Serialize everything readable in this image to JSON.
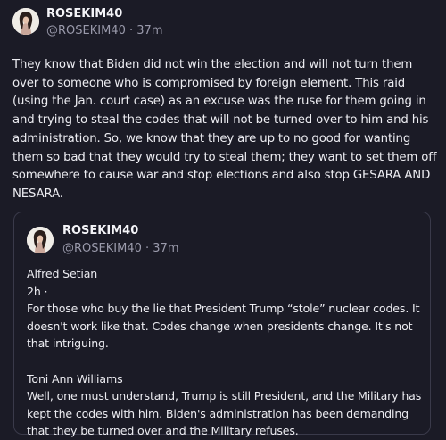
{
  "post": {
    "author_name": "ROSEKIM40",
    "author_handle": "@ROSEKIM40",
    "separator": "·",
    "time": "37m",
    "text": "They know that Biden did not win the election and will not turn them over to someone who is compromised by foreign element. This raid (using the Jan. court case) as an excuse was the ruse for them going in and trying to steal the codes that will not be turned over to him and his administration. So, we know that they are up to no good for wanting them so bad that they would try to steal them; they want to set them off somewhere to cause war and stop elections and also stop GESARA AND NESARA."
  },
  "quote": {
    "author_name": "ROSEKIM40",
    "author_handle": "@ROSEKIM40",
    "separator": "·",
    "time": "37m",
    "line1": "Alfred Setian",
    "line2": "2h ·",
    "line3": "For those who buy the lie that President Trump “stole” nuclear codes. It doesn't work like that. Codes change when presidents change. It's not that intriguing.",
    "line4": "Toni Ann Williams",
    "line5": "Well, one must understand, Trump is still President, and the Military has kept the codes with him. Biden's administration has been demanding that they be turned over and the Military refuses."
  },
  "colors": {
    "background": "#1b1b26",
    "text": "#ececf1",
    "muted": "#9a9aab",
    "border": "#3a3a4a"
  },
  "icons": {
    "avatar": "profile-photo"
  }
}
